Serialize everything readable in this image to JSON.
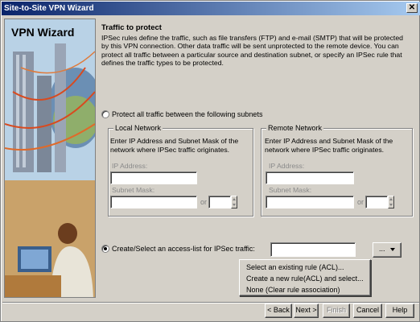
{
  "window": {
    "title": "Site-to-Site VPN Wizard",
    "close_glyph": "✕"
  },
  "art": {
    "title": "VPN Wizard"
  },
  "page": {
    "heading": "Traffic to protect",
    "description": "IPSec rules define the traffic, such as file transfers (FTP) and e-mail (SMTP) that will be protected by this VPN connection. Other data traffic will be sent unprotected to the remote device. You can protect all traffic between a particular source and destination subnet, or specify an IPSec rule that defines the traffic types to be protected."
  },
  "option_subnets": {
    "label": "Protect all traffic between the following subnets",
    "selected": false
  },
  "local_network": {
    "title": "Local Network",
    "desc": "Enter IP Address and Subnet Mask of the network where IPSec traffic originates.",
    "ip_label": "IP Address:",
    "ip_value": "",
    "mask_label": "Subnet Mask:",
    "mask_value": "",
    "or_label": "or",
    "prefix_value": ""
  },
  "remote_network": {
    "title": "Remote Network",
    "desc": "Enter IP Address and Subnet Mask of the network where IPSec traffic originates.",
    "ip_label": "IP Address:",
    "ip_value": "",
    "mask_label": "Subnet Mask:",
    "mask_value": "",
    "or_label": "or",
    "prefix_value": ""
  },
  "option_acl": {
    "label": "Create/Select an access-list for IPSec traffic:",
    "selected": true,
    "value": "",
    "browse_label": "..."
  },
  "acl_menu": {
    "items": [
      "Select an existing rule (ACL)...",
      "Create a new rule(ACL) and select...",
      "None (Clear rule association)"
    ]
  },
  "footer": {
    "back": "< Back",
    "next": "Next >",
    "finish": "Finish",
    "cancel": "Cancel",
    "help": "Help"
  }
}
